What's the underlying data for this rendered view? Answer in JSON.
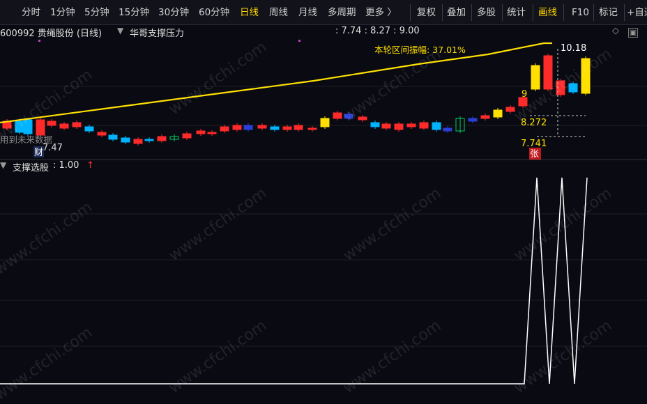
{
  "toolbar": {
    "tabs": [
      {
        "label": "分时",
        "active": false
      },
      {
        "label": "1分钟",
        "active": false
      },
      {
        "label": "5分钟",
        "active": false
      },
      {
        "label": "15分钟",
        "active": false
      },
      {
        "label": "30分钟",
        "active": false
      },
      {
        "label": "60分钟",
        "active": false
      },
      {
        "label": "日线",
        "active": true
      },
      {
        "label": "周线",
        "active": false
      },
      {
        "label": "月线",
        "active": false
      },
      {
        "label": "多周期",
        "active": false
      },
      {
        "label": "更多 〉",
        "active": false
      }
    ],
    "tools": [
      "复权",
      "叠加",
      "多股",
      "统计",
      "画线",
      "F10",
      "标记",
      "+自选"
    ]
  },
  "infobar": {
    "code_name": "600992 贵绳股份 (日线)",
    "indicator": "华哥支撑压力",
    "values": ": 7.74 : 8.27 : 9.00"
  },
  "main_chart": {
    "amplitude_label": "本轮区间振幅: 37.01%",
    "high_label": "10.18",
    "low_label": "7.47",
    "level_9": "9",
    "level_8272": "8.272",
    "level_7741": "7.741",
    "future_data_label": "用到未来数据",
    "cai_marker": "财",
    "zhang_marker": "张"
  },
  "indicator_panel": {
    "name": "支撑选股",
    "value": ": 1.00",
    "arrow": "↑"
  },
  "watermark": "www.cfchi.com",
  "colors": {
    "up": "#ff2a2a",
    "down": "#00c0ff",
    "yellow": "#ffe000",
    "accent": "#ffd600",
    "line": "#ffffff"
  }
}
